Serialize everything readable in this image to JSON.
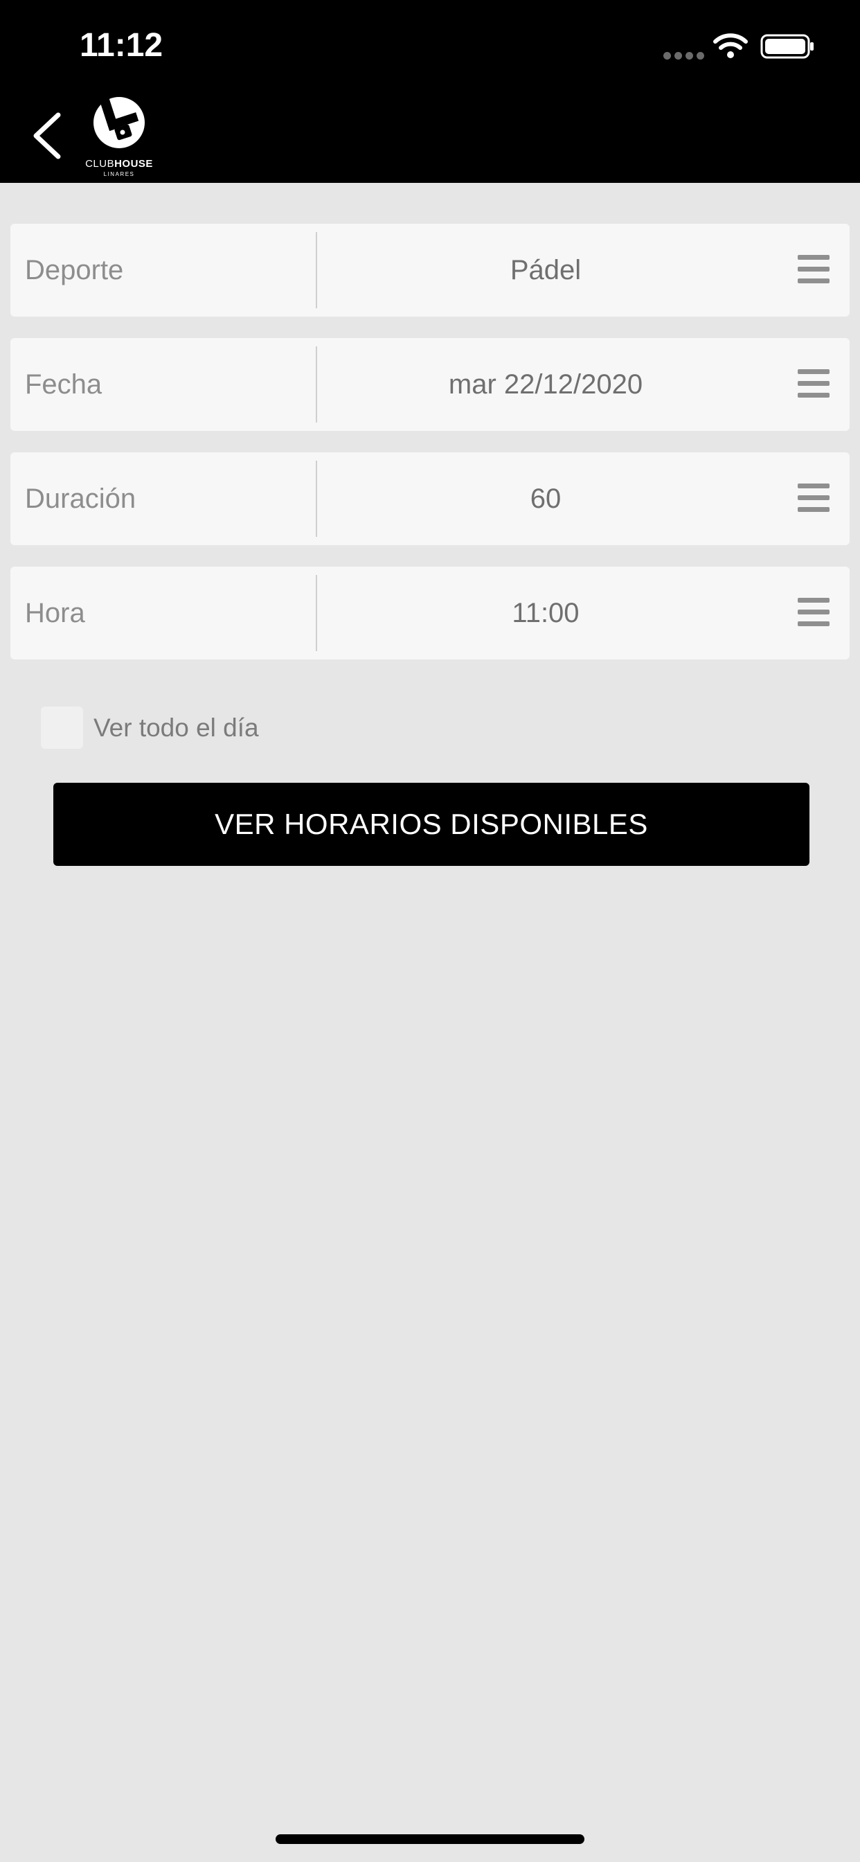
{
  "status_bar": {
    "time": "11:12",
    "icons": [
      "signal-dots",
      "wifi-icon",
      "battery-icon"
    ]
  },
  "header": {
    "back_icon": "chevron-left",
    "logo": {
      "name_light": "CLUB",
      "name_bold": "HOUSE",
      "subtitle": "LINARES"
    }
  },
  "form": {
    "rows": [
      {
        "label": "Deporte",
        "value": "Pádel"
      },
      {
        "label": "Fecha",
        "value": "mar 22/12/2020"
      },
      {
        "label": "Duración",
        "value": "60"
      },
      {
        "label": "Hora",
        "value": "11:00"
      }
    ],
    "whole_day": {
      "label": "Ver todo el día",
      "checked": false
    }
  },
  "actions": {
    "submit_label": "VER HORARIOS DISPONIBLES"
  },
  "colors": {
    "header_bg": "#000000",
    "page_bg": "#e6e6e6",
    "row_bg": "#f7f7f7",
    "button_bg": "#000000",
    "button_text": "#ffffff"
  }
}
